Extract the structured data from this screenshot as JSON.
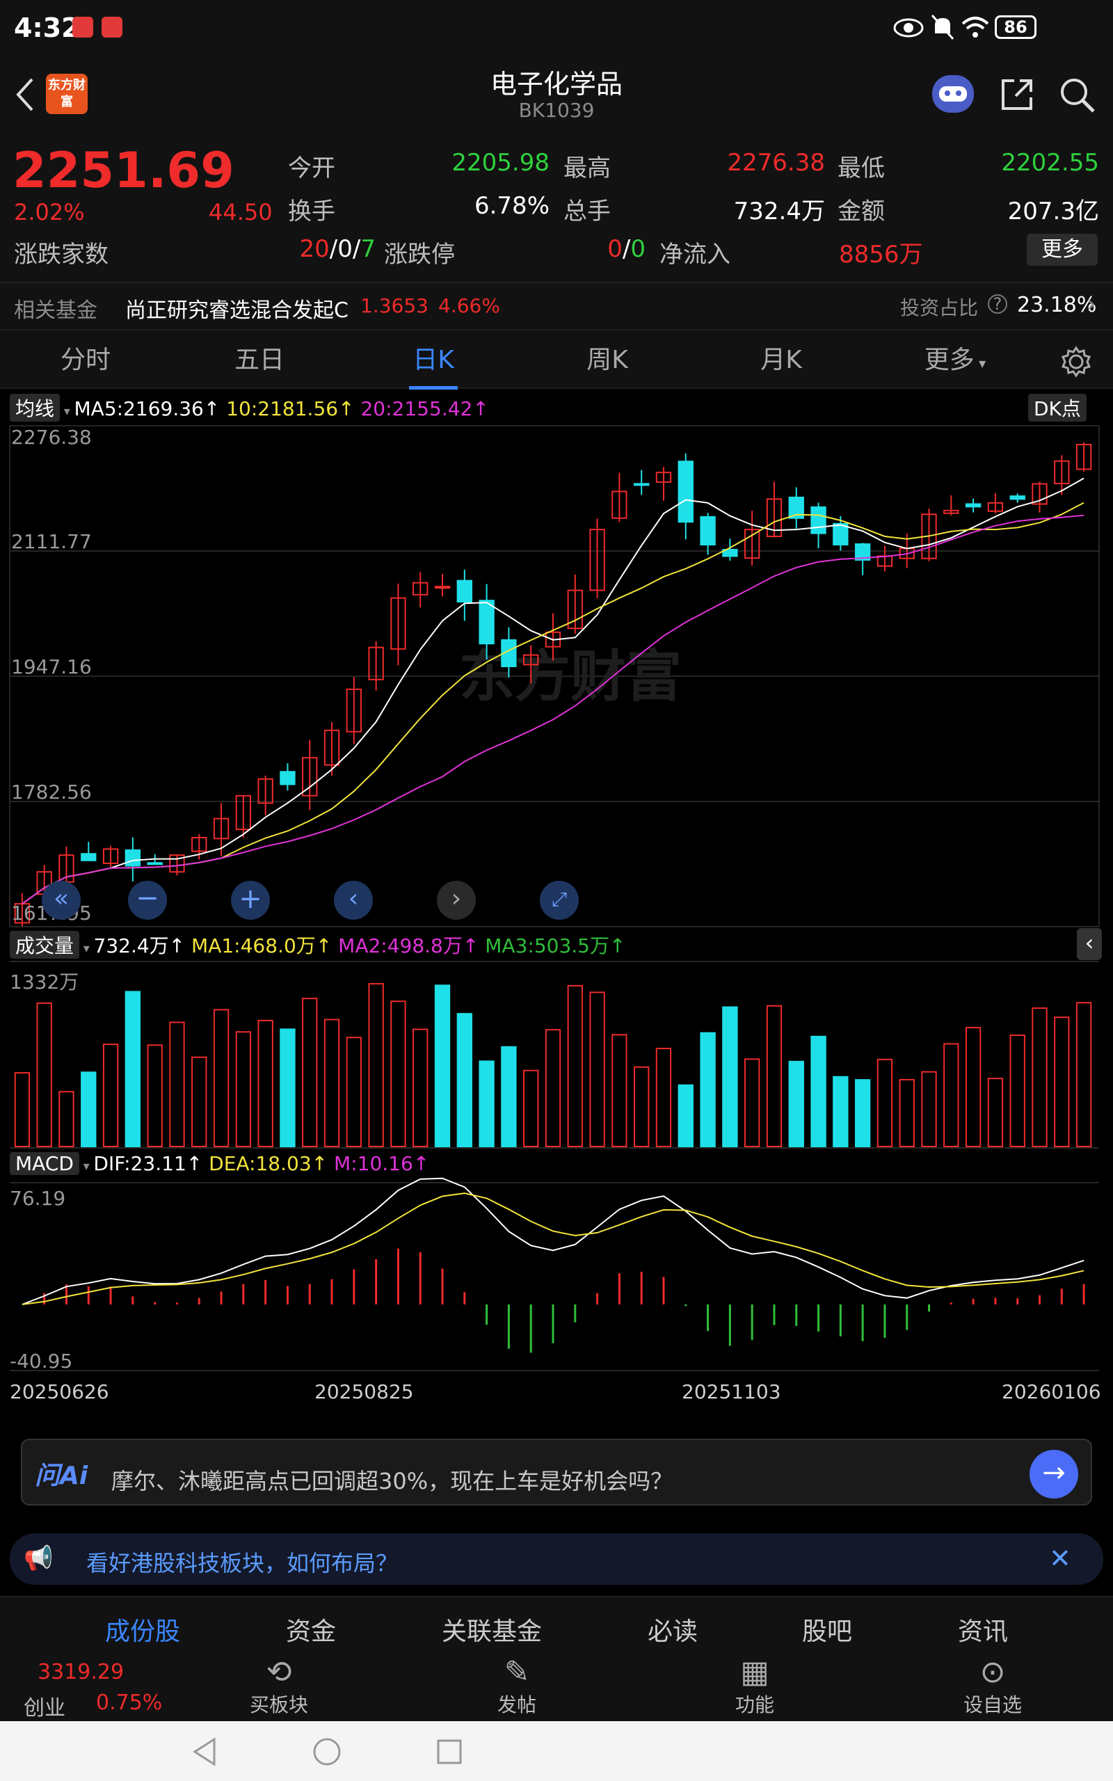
{
  "status_bar": {
    "time": "4:32",
    "battery": "86"
  },
  "header": {
    "title": "电子化学品",
    "code": "BK1039",
    "logo_text": "东方财富"
  },
  "quote": {
    "price": "2251.69",
    "change_pct": "2.02%",
    "change_val": "44.50",
    "open_label": "今开",
    "open": "2205.98",
    "high_label": "最高",
    "high": "2276.38",
    "low_label": "最低",
    "low": "2202.55",
    "turnover_label": "换手",
    "turnover": "6.78%",
    "volume_label": "总手",
    "volume": "732.4万",
    "amount_label": "金额",
    "amount": "207.3亿",
    "breadth_label": "涨跌家数",
    "breadth_up": "20",
    "breadth_flat": "0",
    "breadth_down": "7",
    "limit_label": "涨跌停",
    "limit_up": "0",
    "limit_down": "0",
    "netflow_label": "净流入",
    "netflow": "8856万",
    "more_label": "更多"
  },
  "fund_row": {
    "label": "相关基金",
    "fund_name": "尚正研究睿选混合发起C",
    "nav": "1.3653",
    "change": "4.66%",
    "ratio_label": "投资占比",
    "ratio": "23.18%"
  },
  "tabs": [
    "分时",
    "五日",
    "日K",
    "周K",
    "月K",
    "更多"
  ],
  "active_tab": "日K",
  "kline": {
    "ma_tag": "均线",
    "ma5": "MA5:2169.36",
    "ma10": "10:2181.56",
    "ma20": "20:2155.42",
    "dk_tag": "DK点",
    "y_ticks": [
      "2276.38",
      "2111.77",
      "1947.16",
      "1782.56",
      "1617.95"
    ],
    "watermark": "东方财富"
  },
  "volume": {
    "tag": "成交量",
    "vol": "732.4万",
    "ma1": "MA1:468.0万",
    "ma2": "MA2:498.8万",
    "ma3": "MA3:503.5万",
    "y_top": "1332万"
  },
  "macd": {
    "tag": "MACD",
    "dif": "DIF:23.11",
    "dea": "DEA:18.03",
    "m": "M:10.16",
    "y_top": "76.19",
    "y_bottom": "-40.95"
  },
  "x_dates": [
    "20250626",
    "20250825",
    "20251103",
    "20260106"
  ],
  "ai": {
    "logo": "问Ai",
    "question": "摩尔、沐曦距高点已回调超30%，现在上车是好机会吗？"
  },
  "promo": {
    "text": "看好港股科技板块，如何布局？"
  },
  "bottom_tabs": [
    "成份股",
    "资金",
    "关联基金",
    "必读",
    "股吧",
    "资讯"
  ],
  "bottom_index": {
    "value": "3319.29",
    "name": "创业",
    "change": "0.75%"
  },
  "bottom_actions": [
    "买板块",
    "发帖",
    "功能",
    "设自选"
  ],
  "colors": {
    "up": "#ef2b2b",
    "down": "#1fe0e8",
    "ma5": "#ffffff",
    "ma10": "#f2e43b",
    "ma20": "#e033d9",
    "accent": "#3a86ff"
  },
  "chart_data": {
    "type": "candlestick",
    "title": "电子化学品 BK1039 日K",
    "x_range": [
      "20250626",
      "20260106"
    ],
    "ylim": [
      1617.95,
      2276.38
    ],
    "close_series_approx": [
      1648,
      1690,
      1712,
      1705,
      1720,
      1698,
      1700,
      1712,
      1735,
      1760,
      1790,
      1812,
      1805,
      1840,
      1876,
      1930,
      1985,
      2050,
      2070,
      2065,
      2045,
      1990,
      1960,
      1975,
      2005,
      2060,
      2140,
      2190,
      2200,
      2215,
      2150,
      2120,
      2105,
      2140,
      2180,
      2155,
      2135,
      2120,
      2100,
      2105,
      2115,
      2160,
      2165,
      2170,
      2175,
      2180,
      2200,
      2230,
      2251.69
    ],
    "volume_max": "1332万",
    "macd_range": [
      -40.95,
      76.19
    ]
  }
}
